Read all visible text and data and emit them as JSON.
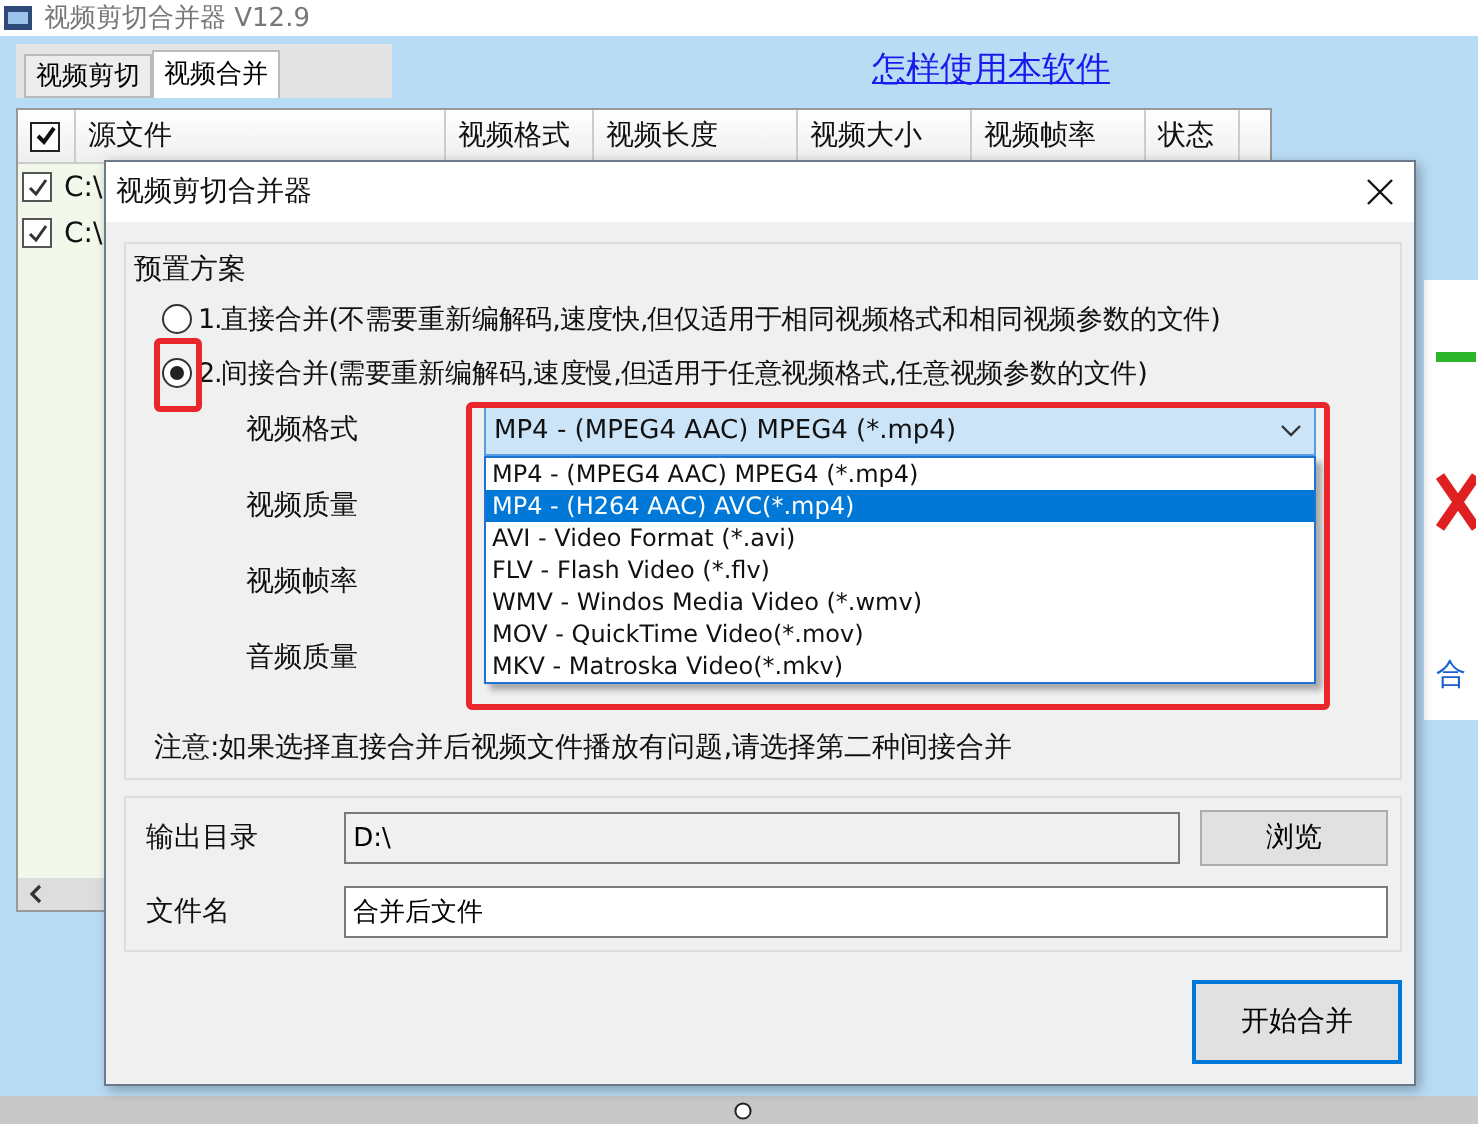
{
  "main_window": {
    "title": "视频剪切合并器 V12.9",
    "tabs": [
      {
        "label": "视频剪切",
        "selected": false
      },
      {
        "label": "视频合并",
        "selected": true
      }
    ],
    "help_link": "怎样使用本软件",
    "file_list": {
      "header_checked": true,
      "columns": [
        "源文件",
        "视频格式",
        "视频长度",
        "视频大小",
        "视频帧率",
        "状态"
      ],
      "rows": [
        {
          "checked": true,
          "source": "C:\\"
        },
        {
          "checked": true,
          "source": "C:\\"
        }
      ]
    },
    "side_text": "合"
  },
  "dialog": {
    "title": "视频剪切合并器",
    "preset_group": {
      "title": "预置方案",
      "options": [
        {
          "label": "1.直接合并(不需要重新编解码,速度快,但仅适用于相同视频格式和相同视频参数的文件)",
          "selected": false
        },
        {
          "label": "2.间接合并(需要重新编解码,速度慢,但适用于任意视频格式,任意视频参数的文件)",
          "selected": true
        }
      ]
    },
    "field_labels": [
      "视频格式",
      "视频质量",
      "视频帧率",
      "音频质量"
    ],
    "format_select": {
      "value": "MP4 - (MPEG4 AAC) MPEG4 (*.mp4)",
      "expanded": true,
      "options": [
        {
          "label": "MP4 - (MPEG4 AAC) MPEG4 (*.mp4)",
          "highlighted": false
        },
        {
          "label": "MP4 - (H264 AAC) AVC(*.mp4)",
          "highlighted": true
        },
        {
          "label": "AVI - Video Format (*.avi)",
          "highlighted": false
        },
        {
          "label": "FLV - Flash Video (*.flv)",
          "highlighted": false
        },
        {
          "label": "WMV - Windos Media Video (*.wmv)",
          "highlighted": false
        },
        {
          "label": "MOV - QuickTime Video(*.mov)",
          "highlighted": false
        },
        {
          "label": "MKV - Matroska Video(*.mkv)",
          "highlighted": false
        }
      ]
    },
    "note": "注意:如果选择直接合并后视频文件播放有问题,请选择第二种间接合并",
    "output_dir": {
      "label": "输出目录",
      "value": "D:\\"
    },
    "browse_button": "浏览",
    "file_name": {
      "label": "文件名",
      "value": "合并后文件"
    },
    "start_button": "开始合并"
  }
}
